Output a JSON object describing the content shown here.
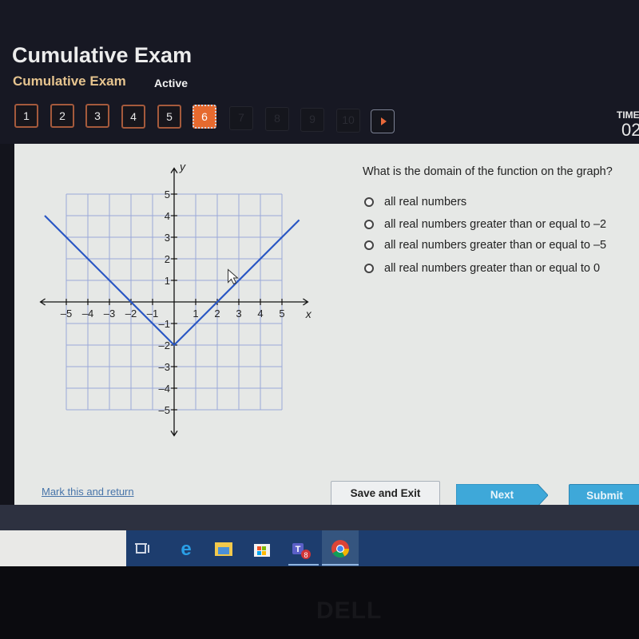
{
  "header": {
    "app_title": "Cumulative Exam",
    "sub_title": "Cumulative Exam",
    "status": "Active",
    "timer_label": "TIME",
    "timer_value": "02",
    "accent_color": "#e66a2f"
  },
  "question_nav": {
    "items": [
      {
        "label": "1",
        "state": "answered"
      },
      {
        "label": "2",
        "state": "answered"
      },
      {
        "label": "3",
        "state": "answered"
      },
      {
        "label": "4",
        "state": "answered"
      },
      {
        "label": "5",
        "state": "answered"
      },
      {
        "label": "6",
        "state": "current"
      },
      {
        "label": "7",
        "state": "locked"
      },
      {
        "label": "8",
        "state": "locked"
      },
      {
        "label": "9",
        "state": "locked"
      },
      {
        "label": "10",
        "state": "locked"
      }
    ],
    "next_icon": "play-triangle-icon",
    "current": 6
  },
  "question": {
    "text": "What is the domain of the function on the graph?",
    "choices": [
      "all real numbers",
      "all real numbers greater than or equal to –2",
      "all real numbers greater than or equal to –5",
      "all real numbers greater than or equal to 0"
    ],
    "selected": null
  },
  "chart_data": {
    "type": "line",
    "title": "",
    "xlabel": "x",
    "ylabel": "y",
    "xlim": [
      -5,
      5
    ],
    "ylim": [
      -5,
      5
    ],
    "grid": true,
    "x_ticks": [
      "–5",
      "–4",
      "–3",
      "–2",
      "–1",
      "1",
      "2",
      "3",
      "4",
      "5"
    ],
    "y_ticks": [
      "5",
      "4",
      "3",
      "2",
      "1",
      "–1",
      "–2",
      "–3",
      "–4",
      "–5"
    ],
    "series": [
      {
        "name": "y = |x| – 2",
        "color": "#2a57c4",
        "arrows": "none",
        "points": [
          [
            -6,
            4
          ],
          [
            0,
            -2
          ],
          [
            5.8,
            3.8
          ]
        ]
      }
    ]
  },
  "footer": {
    "mark_link": "Mark this and return",
    "save_exit": "Save and Exit",
    "next": "Next",
    "submit": "Submit"
  },
  "taskbar": {
    "icons": [
      "task-view-icon",
      "edge-icon",
      "file-explorer-icon",
      "store-icon",
      "teams-icon",
      "chrome-icon"
    ],
    "teams_badge": "8"
  },
  "bezel": {
    "brand": "DELL"
  }
}
